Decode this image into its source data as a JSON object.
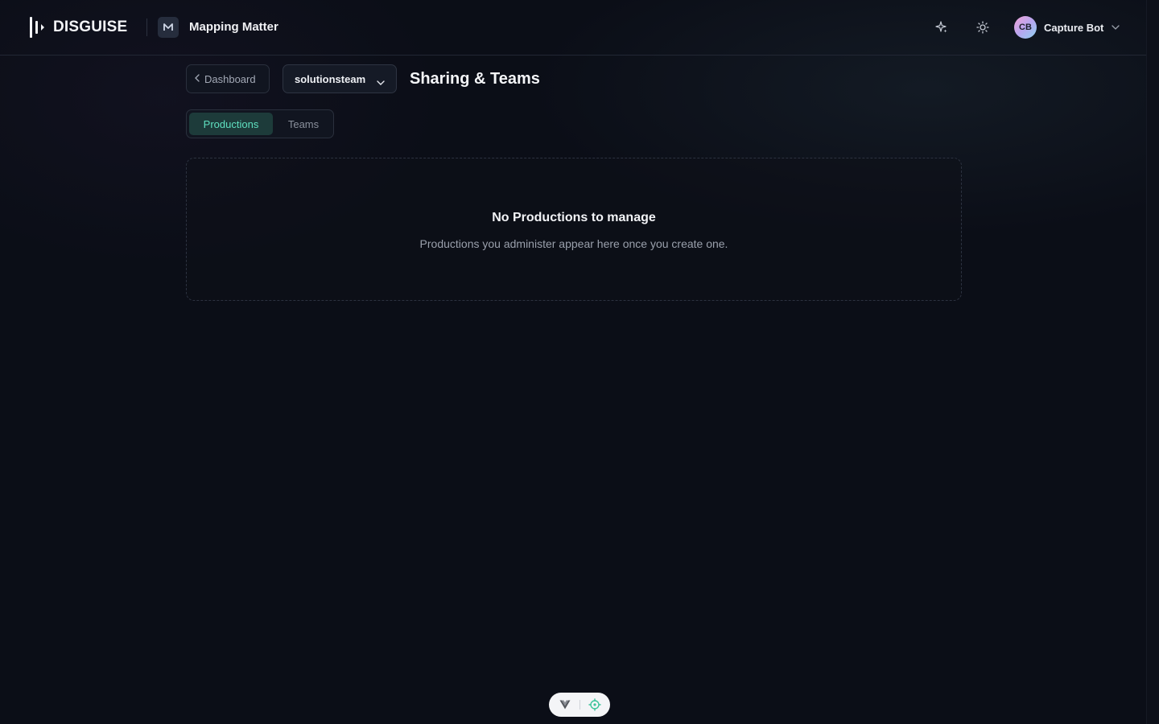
{
  "header": {
    "brand": "DISGUISE",
    "app_title": "Mapping Matter",
    "user": {
      "initials": "CB",
      "name": "Capture Bot"
    },
    "icons": [
      "sparkle-icon",
      "sun-icon",
      "chevron-down-icon"
    ]
  },
  "toolbar": {
    "back_label": "Dashboard",
    "team_select_value": "solutionsteam",
    "page_title": "Sharing & Teams"
  },
  "tabs": [
    {
      "label": "Productions",
      "active": true
    },
    {
      "label": "Teams",
      "active": false
    }
  ],
  "empty_state": {
    "title": "No Productions to manage",
    "subtitle": "Productions you administer appear here once you create one."
  },
  "colors": {
    "background": "#0b0e17",
    "accent": "#5fe0c0",
    "active_tab_bg": "#1d3b3a"
  }
}
